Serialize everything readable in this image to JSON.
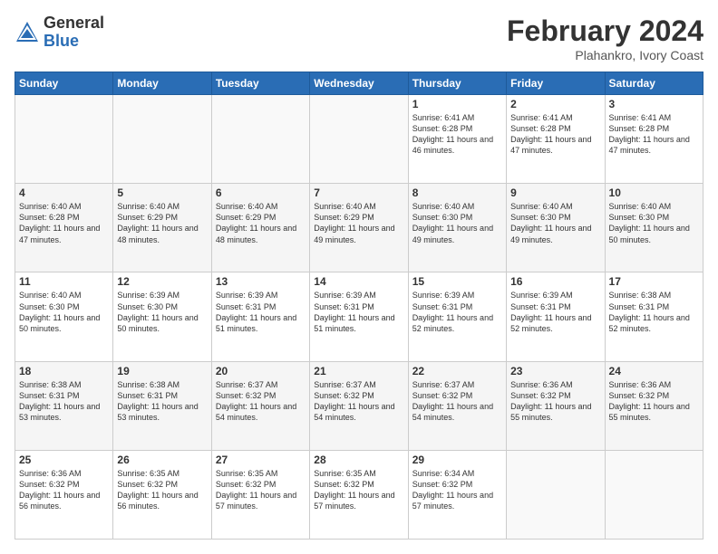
{
  "header": {
    "logo_general": "General",
    "logo_blue": "Blue",
    "main_title": "February 2024",
    "subtitle": "Plahankro, Ivory Coast"
  },
  "days_of_week": [
    "Sunday",
    "Monday",
    "Tuesday",
    "Wednesday",
    "Thursday",
    "Friday",
    "Saturday"
  ],
  "weeks": [
    [
      {
        "day": "",
        "info": ""
      },
      {
        "day": "",
        "info": ""
      },
      {
        "day": "",
        "info": ""
      },
      {
        "day": "",
        "info": ""
      },
      {
        "day": "1",
        "info": "Sunrise: 6:41 AM\nSunset: 6:28 PM\nDaylight: 11 hours and 46 minutes."
      },
      {
        "day": "2",
        "info": "Sunrise: 6:41 AM\nSunset: 6:28 PM\nDaylight: 11 hours and 47 minutes."
      },
      {
        "day": "3",
        "info": "Sunrise: 6:41 AM\nSunset: 6:28 PM\nDaylight: 11 hours and 47 minutes."
      }
    ],
    [
      {
        "day": "4",
        "info": "Sunrise: 6:40 AM\nSunset: 6:28 PM\nDaylight: 11 hours and 47 minutes."
      },
      {
        "day": "5",
        "info": "Sunrise: 6:40 AM\nSunset: 6:29 PM\nDaylight: 11 hours and 48 minutes."
      },
      {
        "day": "6",
        "info": "Sunrise: 6:40 AM\nSunset: 6:29 PM\nDaylight: 11 hours and 48 minutes."
      },
      {
        "day": "7",
        "info": "Sunrise: 6:40 AM\nSunset: 6:29 PM\nDaylight: 11 hours and 49 minutes."
      },
      {
        "day": "8",
        "info": "Sunrise: 6:40 AM\nSunset: 6:30 PM\nDaylight: 11 hours and 49 minutes."
      },
      {
        "day": "9",
        "info": "Sunrise: 6:40 AM\nSunset: 6:30 PM\nDaylight: 11 hours and 49 minutes."
      },
      {
        "day": "10",
        "info": "Sunrise: 6:40 AM\nSunset: 6:30 PM\nDaylight: 11 hours and 50 minutes."
      }
    ],
    [
      {
        "day": "11",
        "info": "Sunrise: 6:40 AM\nSunset: 6:30 PM\nDaylight: 11 hours and 50 minutes."
      },
      {
        "day": "12",
        "info": "Sunrise: 6:39 AM\nSunset: 6:30 PM\nDaylight: 11 hours and 50 minutes."
      },
      {
        "day": "13",
        "info": "Sunrise: 6:39 AM\nSunset: 6:31 PM\nDaylight: 11 hours and 51 minutes."
      },
      {
        "day": "14",
        "info": "Sunrise: 6:39 AM\nSunset: 6:31 PM\nDaylight: 11 hours and 51 minutes."
      },
      {
        "day": "15",
        "info": "Sunrise: 6:39 AM\nSunset: 6:31 PM\nDaylight: 11 hours and 52 minutes."
      },
      {
        "day": "16",
        "info": "Sunrise: 6:39 AM\nSunset: 6:31 PM\nDaylight: 11 hours and 52 minutes."
      },
      {
        "day": "17",
        "info": "Sunrise: 6:38 AM\nSunset: 6:31 PM\nDaylight: 11 hours and 52 minutes."
      }
    ],
    [
      {
        "day": "18",
        "info": "Sunrise: 6:38 AM\nSunset: 6:31 PM\nDaylight: 11 hours and 53 minutes."
      },
      {
        "day": "19",
        "info": "Sunrise: 6:38 AM\nSunset: 6:31 PM\nDaylight: 11 hours and 53 minutes."
      },
      {
        "day": "20",
        "info": "Sunrise: 6:37 AM\nSunset: 6:32 PM\nDaylight: 11 hours and 54 minutes."
      },
      {
        "day": "21",
        "info": "Sunrise: 6:37 AM\nSunset: 6:32 PM\nDaylight: 11 hours and 54 minutes."
      },
      {
        "day": "22",
        "info": "Sunrise: 6:37 AM\nSunset: 6:32 PM\nDaylight: 11 hours and 54 minutes."
      },
      {
        "day": "23",
        "info": "Sunrise: 6:36 AM\nSunset: 6:32 PM\nDaylight: 11 hours and 55 minutes."
      },
      {
        "day": "24",
        "info": "Sunrise: 6:36 AM\nSunset: 6:32 PM\nDaylight: 11 hours and 55 minutes."
      }
    ],
    [
      {
        "day": "25",
        "info": "Sunrise: 6:36 AM\nSunset: 6:32 PM\nDaylight: 11 hours and 56 minutes."
      },
      {
        "day": "26",
        "info": "Sunrise: 6:35 AM\nSunset: 6:32 PM\nDaylight: 11 hours and 56 minutes."
      },
      {
        "day": "27",
        "info": "Sunrise: 6:35 AM\nSunset: 6:32 PM\nDaylight: 11 hours and 57 minutes."
      },
      {
        "day": "28",
        "info": "Sunrise: 6:35 AM\nSunset: 6:32 PM\nDaylight: 11 hours and 57 minutes."
      },
      {
        "day": "29",
        "info": "Sunrise: 6:34 AM\nSunset: 6:32 PM\nDaylight: 11 hours and 57 minutes."
      },
      {
        "day": "",
        "info": ""
      },
      {
        "day": "",
        "info": ""
      }
    ]
  ]
}
